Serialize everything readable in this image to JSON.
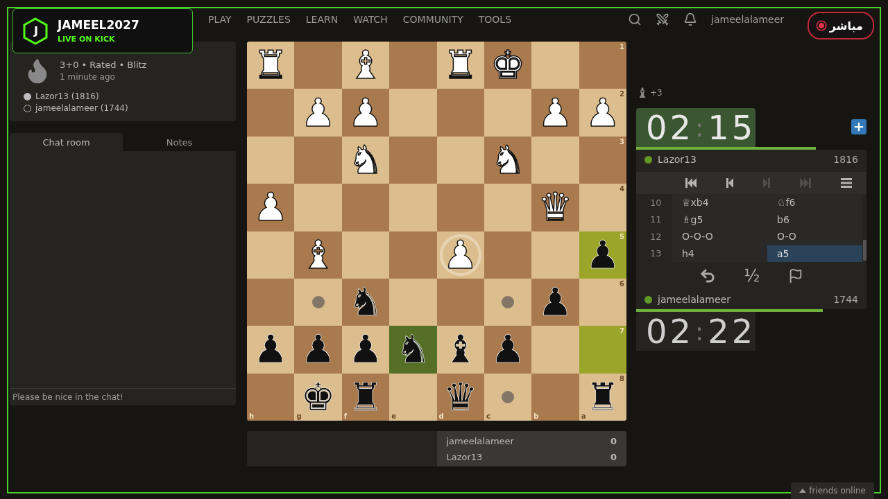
{
  "overlay": {
    "logo_letter": "J",
    "streamer": "JAMEEL2027",
    "platform": "LIVE ON KICK",
    "live_badge": "مباشر"
  },
  "nav": {
    "items": [
      "PLAY",
      "PUZZLES",
      "LEARN",
      "WATCH",
      "COMMUNITY",
      "TOOLS"
    ],
    "username": "jameelalameer"
  },
  "game_info": {
    "title": "3+0 • Rated • Blitz",
    "time": "1 minute ago",
    "players": [
      {
        "name": "Lazor13 (1816)",
        "white": true
      },
      {
        "name": "jameelalameer (1744)",
        "white": false
      }
    ]
  },
  "chat": {
    "tabs": [
      {
        "label": "Chat room",
        "selected": true
      },
      {
        "label": "Notes",
        "selected": false
      }
    ],
    "placeholder": "Please be nice in the chat!"
  },
  "board": {
    "rank_labels": [
      "1",
      "2",
      "3",
      "4",
      "5",
      "6",
      "7",
      "8"
    ],
    "file_labels": [
      "h",
      "g",
      "f",
      "e",
      "d",
      "c",
      "b",
      "a"
    ],
    "rows": [
      [
        {
          "piece": "♜",
          "white": true,
          "last_move": false,
          "selected": false,
          "target": false
        },
        {
          "last_move": false,
          "selected": false,
          "target": false
        },
        {
          "piece": "♝",
          "white": true,
          "last_move": false,
          "selected": false,
          "target": false
        },
        {
          "last_move": false,
          "selected": false,
          "target": false
        },
        {
          "piece": "♜",
          "white": true,
          "last_move": false,
          "selected": false,
          "target": false
        },
        {
          "piece": "♚",
          "white": true,
          "last_move": false,
          "selected": false,
          "target": false
        },
        {
          "last_move": false,
          "selected": false,
          "target": false
        },
        {
          "last_move": false,
          "selected": false,
          "target": false
        }
      ],
      [
        {
          "last_move": false,
          "selected": false,
          "target": false
        },
        {
          "piece": "♟",
          "white": true,
          "last_move": false,
          "selected": false,
          "target": false
        },
        {
          "piece": "♟",
          "white": true,
          "last_move": false,
          "selected": false,
          "target": false
        },
        {
          "last_move": false,
          "selected": false,
          "target": false
        },
        {
          "last_move": false,
          "selected": false,
          "target": false
        },
        {
          "last_move": false,
          "selected": false,
          "target": false
        },
        {
          "piece": "♟",
          "white": true,
          "last_move": false,
          "selected": false,
          "target": false
        },
        {
          "piece": "♟",
          "white": true,
          "last_move": false,
          "selected": false,
          "target": false
        }
      ],
      [
        {
          "last_move": false,
          "selected": false,
          "target": false
        },
        {
          "last_move": false,
          "selected": false,
          "target": false
        },
        {
          "piece": "♞",
          "white": true,
          "last_move": false,
          "selected": false,
          "target": false
        },
        {
          "last_move": false,
          "selected": false,
          "target": false
        },
        {
          "last_move": false,
          "selected": false,
          "target": false
        },
        {
          "piece": "♞",
          "white": true,
          "last_move": false,
          "selected": false,
          "target": false
        },
        {
          "last_move": false,
          "selected": false,
          "target": false
        },
        {
          "last_move": false,
          "selected": false,
          "target": false
        }
      ],
      [
        {
          "piece": "♟",
          "white": true,
          "last_move": false,
          "selected": false,
          "target": false
        },
        {
          "last_move": false,
          "selected": false,
          "target": false
        },
        {
          "last_move": false,
          "selected": false,
          "target": false
        },
        {
          "last_move": false,
          "selected": false,
          "target": false
        },
        {
          "last_move": false,
          "selected": false,
          "target": false
        },
        {
          "last_move": false,
          "selected": false,
          "target": false
        },
        {
          "piece": "♛",
          "white": true,
          "last_move": false,
          "selected": false,
          "target": false
        },
        {
          "last_move": false,
          "selected": false,
          "target": false
        }
      ],
      [
        {
          "last_move": false,
          "selected": false,
          "target": false
        },
        {
          "piece": "♝",
          "white": true,
          "last_move": false,
          "selected": false,
          "target": false
        },
        {
          "last_move": false,
          "selected": false,
          "target": false
        },
        {
          "last_move": false,
          "selected": false,
          "target": false
        },
        {
          "piece": "♟",
          "white": true,
          "last_move": false,
          "selected": false,
          "target": true
        },
        {
          "last_move": false,
          "selected": false,
          "target": false
        },
        {
          "last_move": false,
          "selected": false,
          "target": false
        },
        {
          "piece": "♟",
          "white": false,
          "last_move": true,
          "selected": false,
          "target": false
        }
      ],
      [
        {
          "last_move": false,
          "selected": false,
          "target": false
        },
        {
          "last_move": false,
          "selected": false,
          "target": true
        },
        {
          "piece": "♞",
          "white": false,
          "last_move": false,
          "selected": false,
          "target": false
        },
        {
          "last_move": false,
          "selected": false,
          "target": false
        },
        {
          "last_move": false,
          "selected": false,
          "target": false
        },
        {
          "last_move": false,
          "selected": false,
          "target": true
        },
        {
          "piece": "♟",
          "white": false,
          "last_move": false,
          "selected": false,
          "target": false
        },
        {
          "last_move": false,
          "selected": false,
          "target": false
        }
      ],
      [
        {
          "piece": "♟",
          "white": false,
          "last_move": false,
          "selected": false,
          "target": false
        },
        {
          "piece": "♟",
          "white": false,
          "last_move": false,
          "selected": false,
          "target": false
        },
        {
          "piece": "♟",
          "white": false,
          "last_move": false,
          "selected": false,
          "target": false
        },
        {
          "piece": "♞",
          "white": false,
          "last_move": false,
          "selected": true,
          "target": false
        },
        {
          "piece": "♝",
          "white": false,
          "last_move": false,
          "selected": false,
          "target": false
        },
        {
          "piece": "♟",
          "white": false,
          "last_move": false,
          "selected": false,
          "target": false
        },
        {
          "last_move": false,
          "selected": false,
          "target": false
        },
        {
          "last_move": true,
          "selected": false,
          "target": false
        }
      ],
      [
        {
          "last_move": false,
          "selected": false,
          "target": false
        },
        {
          "piece": "♚",
          "white": false,
          "last_move": false,
          "selected": false,
          "target": false
        },
        {
          "piece": "♜",
          "white": false,
          "last_move": false,
          "selected": false,
          "target": false
        },
        {
          "last_move": false,
          "selected": false,
          "target": false
        },
        {
          "piece": "♛",
          "white": false,
          "last_move": false,
          "selected": false,
          "target": false
        },
        {
          "last_move": false,
          "selected": false,
          "target": true
        },
        {
          "last_move": false,
          "selected": false,
          "target": false
        },
        {
          "piece": "♜",
          "white": false,
          "last_move": false,
          "selected": false,
          "target": false
        }
      ]
    ]
  },
  "scores": [
    {
      "name": "jameelalameer",
      "score": "0"
    },
    {
      "name": "Lazor13",
      "score": "0"
    }
  ],
  "material": {
    "piece": "♝",
    "advantage": "+3"
  },
  "top_player": {
    "clock": {
      "minutes": "02",
      "separator": ":",
      "seconds": "15",
      "running": true
    },
    "level": 0.78,
    "name": "Lazor13",
    "rating": "1816",
    "online": true
  },
  "controls": [
    {
      "kind": "first",
      "disabled": false
    },
    {
      "kind": "prev",
      "disabled": false
    },
    {
      "kind": "next",
      "disabled": true
    },
    {
      "kind": "last",
      "disabled": true
    },
    {
      "kind": "menu",
      "disabled": false
    }
  ],
  "moves": [
    {
      "number": "10",
      "white": {
        "san": "♕xb4",
        "selected": false
      },
      "black": {
        "san": "♘f6",
        "selected": false
      }
    },
    {
      "number": "11",
      "white": {
        "san": "♗g5",
        "selected": false
      },
      "black": {
        "san": "b6",
        "selected": false
      }
    },
    {
      "number": "12",
      "white": {
        "san": "O-O-O",
        "selected": false
      },
      "black": {
        "san": "O-O",
        "selected": false
      }
    },
    {
      "number": "13",
      "white": {
        "san": "h4",
        "selected": false
      },
      "black": {
        "san": "a5",
        "selected": true
      }
    }
  ],
  "actions": [
    {
      "kind": "takeback"
    },
    {
      "kind": "draw",
      "label": "½"
    },
    {
      "kind": "resign"
    }
  ],
  "bottom_player": {
    "name": "jameelalameer",
    "rating": "1744",
    "online": true,
    "level": 0.81,
    "clock": {
      "minutes": "02",
      "separator": ":",
      "seconds": "22",
      "running": false
    }
  },
  "friends": {
    "label": "friends online"
  }
}
